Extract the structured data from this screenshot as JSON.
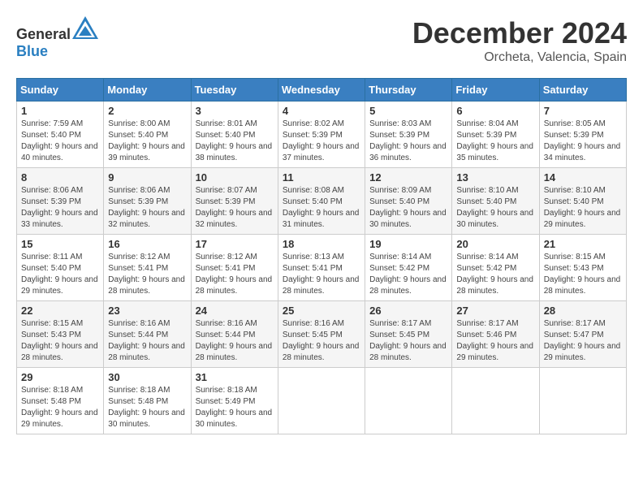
{
  "header": {
    "logo_general": "General",
    "logo_blue": "Blue",
    "month": "December 2024",
    "location": "Orcheta, Valencia, Spain"
  },
  "calendar": {
    "weekdays": [
      "Sunday",
      "Monday",
      "Tuesday",
      "Wednesday",
      "Thursday",
      "Friday",
      "Saturday"
    ],
    "weeks": [
      [
        {
          "day": "",
          "info": ""
        },
        {
          "day": "2",
          "info": "Sunrise: 8:00 AM\nSunset: 5:40 PM\nDaylight: 9 hours and 39 minutes."
        },
        {
          "day": "3",
          "info": "Sunrise: 8:01 AM\nSunset: 5:40 PM\nDaylight: 9 hours and 38 minutes."
        },
        {
          "day": "4",
          "info": "Sunrise: 8:02 AM\nSunset: 5:39 PM\nDaylight: 9 hours and 37 minutes."
        },
        {
          "day": "5",
          "info": "Sunrise: 8:03 AM\nSunset: 5:39 PM\nDaylight: 9 hours and 36 minutes."
        },
        {
          "day": "6",
          "info": "Sunrise: 8:04 AM\nSunset: 5:39 PM\nDaylight: 9 hours and 35 minutes."
        },
        {
          "day": "7",
          "info": "Sunrise: 8:05 AM\nSunset: 5:39 PM\nDaylight: 9 hours and 34 minutes."
        }
      ],
      [
        {
          "day": "8",
          "info": "Sunrise: 8:06 AM\nSunset: 5:39 PM\nDaylight: 9 hours and 33 minutes."
        },
        {
          "day": "9",
          "info": "Sunrise: 8:06 AM\nSunset: 5:39 PM\nDaylight: 9 hours and 32 minutes."
        },
        {
          "day": "10",
          "info": "Sunrise: 8:07 AM\nSunset: 5:39 PM\nDaylight: 9 hours and 32 minutes."
        },
        {
          "day": "11",
          "info": "Sunrise: 8:08 AM\nSunset: 5:40 PM\nDaylight: 9 hours and 31 minutes."
        },
        {
          "day": "12",
          "info": "Sunrise: 8:09 AM\nSunset: 5:40 PM\nDaylight: 9 hours and 30 minutes."
        },
        {
          "day": "13",
          "info": "Sunrise: 8:10 AM\nSunset: 5:40 PM\nDaylight: 9 hours and 30 minutes."
        },
        {
          "day": "14",
          "info": "Sunrise: 8:10 AM\nSunset: 5:40 PM\nDaylight: 9 hours and 29 minutes."
        }
      ],
      [
        {
          "day": "15",
          "info": "Sunrise: 8:11 AM\nSunset: 5:40 PM\nDaylight: 9 hours and 29 minutes."
        },
        {
          "day": "16",
          "info": "Sunrise: 8:12 AM\nSunset: 5:41 PM\nDaylight: 9 hours and 28 minutes."
        },
        {
          "day": "17",
          "info": "Sunrise: 8:12 AM\nSunset: 5:41 PM\nDaylight: 9 hours and 28 minutes."
        },
        {
          "day": "18",
          "info": "Sunrise: 8:13 AM\nSunset: 5:41 PM\nDaylight: 9 hours and 28 minutes."
        },
        {
          "day": "19",
          "info": "Sunrise: 8:14 AM\nSunset: 5:42 PM\nDaylight: 9 hours and 28 minutes."
        },
        {
          "day": "20",
          "info": "Sunrise: 8:14 AM\nSunset: 5:42 PM\nDaylight: 9 hours and 28 minutes."
        },
        {
          "day": "21",
          "info": "Sunrise: 8:15 AM\nSunset: 5:43 PM\nDaylight: 9 hours and 28 minutes."
        }
      ],
      [
        {
          "day": "22",
          "info": "Sunrise: 8:15 AM\nSunset: 5:43 PM\nDaylight: 9 hours and 28 minutes."
        },
        {
          "day": "23",
          "info": "Sunrise: 8:16 AM\nSunset: 5:44 PM\nDaylight: 9 hours and 28 minutes."
        },
        {
          "day": "24",
          "info": "Sunrise: 8:16 AM\nSunset: 5:44 PM\nDaylight: 9 hours and 28 minutes."
        },
        {
          "day": "25",
          "info": "Sunrise: 8:16 AM\nSunset: 5:45 PM\nDaylight: 9 hours and 28 minutes."
        },
        {
          "day": "26",
          "info": "Sunrise: 8:17 AM\nSunset: 5:45 PM\nDaylight: 9 hours and 28 minutes."
        },
        {
          "day": "27",
          "info": "Sunrise: 8:17 AM\nSunset: 5:46 PM\nDaylight: 9 hours and 29 minutes."
        },
        {
          "day": "28",
          "info": "Sunrise: 8:17 AM\nSunset: 5:47 PM\nDaylight: 9 hours and 29 minutes."
        }
      ],
      [
        {
          "day": "29",
          "info": "Sunrise: 8:18 AM\nSunset: 5:48 PM\nDaylight: 9 hours and 29 minutes."
        },
        {
          "day": "30",
          "info": "Sunrise: 8:18 AM\nSunset: 5:48 PM\nDaylight: 9 hours and 30 minutes."
        },
        {
          "day": "31",
          "info": "Sunrise: 8:18 AM\nSunset: 5:49 PM\nDaylight: 9 hours and 30 minutes."
        },
        {
          "day": "",
          "info": ""
        },
        {
          "day": "",
          "info": ""
        },
        {
          "day": "",
          "info": ""
        },
        {
          "day": "",
          "info": ""
        }
      ]
    ],
    "week1_day1": {
      "day": "1",
      "info": "Sunrise: 7:59 AM\nSunset: 5:40 PM\nDaylight: 9 hours and 40 minutes."
    }
  }
}
